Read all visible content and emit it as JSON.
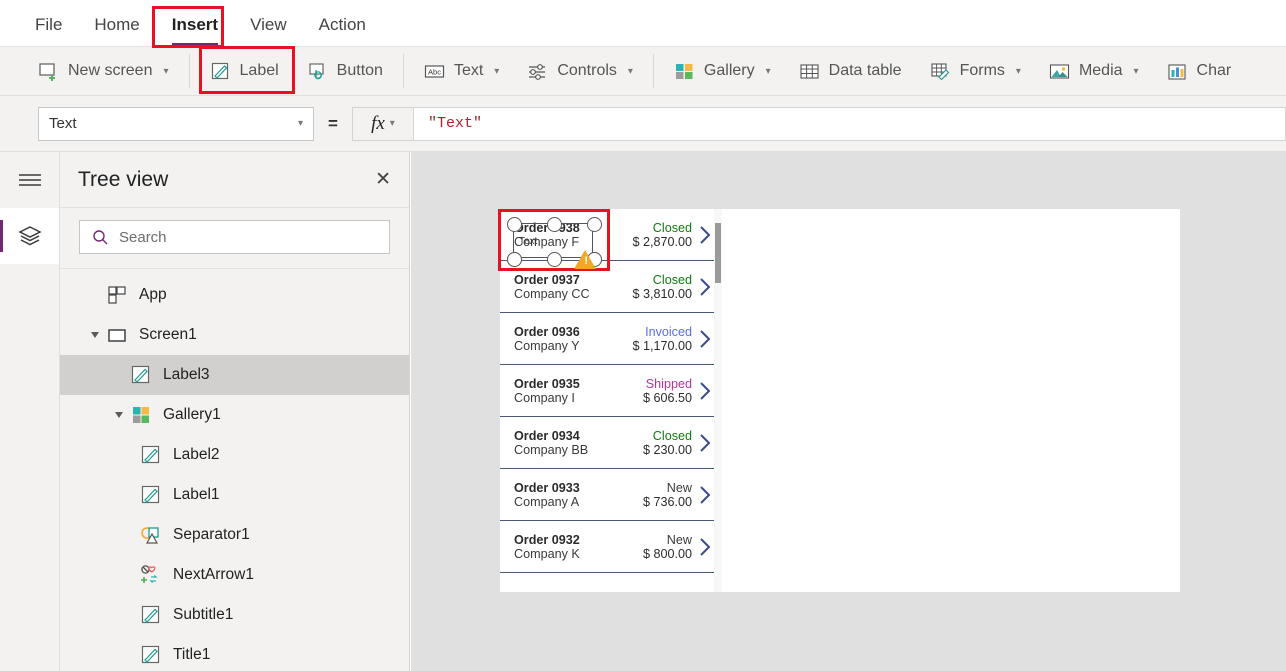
{
  "menu": {
    "tabs": [
      {
        "label": "File",
        "active": false
      },
      {
        "label": "Home",
        "active": false
      },
      {
        "label": "Insert",
        "active": true
      },
      {
        "label": "View",
        "active": false
      },
      {
        "label": "Action",
        "active": false
      }
    ]
  },
  "ribbon": {
    "items": [
      {
        "label": "New screen",
        "icon": "new-screen-icon",
        "caret": true
      },
      {
        "label": "Label",
        "icon": "label-icon",
        "caret": false
      },
      {
        "label": "Button",
        "icon": "button-icon",
        "caret": false
      },
      {
        "label": "Text",
        "icon": "text-abc-icon",
        "caret": true
      },
      {
        "label": "Controls",
        "icon": "controls-sliders-icon",
        "caret": true
      },
      {
        "label": "Gallery",
        "icon": "gallery-icon",
        "caret": true
      },
      {
        "label": "Data table",
        "icon": "data-table-icon",
        "caret": false
      },
      {
        "label": "Forms",
        "icon": "forms-icon",
        "caret": true
      },
      {
        "label": "Media",
        "icon": "media-image-icon",
        "caret": true
      },
      {
        "label": "Char",
        "icon": "chart-bars-icon",
        "caret": false
      }
    ]
  },
  "formula_bar": {
    "property": "Text",
    "equals": "=",
    "fx_label": "fx",
    "value": "\"Text\""
  },
  "tree_view": {
    "title": "Tree view",
    "close_icon": "✕",
    "search": {
      "placeholder": "Search",
      "value": ""
    },
    "items": [
      {
        "label": "App",
        "icon": "app-icon",
        "indent": 0,
        "twisty": false,
        "selected": false
      },
      {
        "label": "Screen1",
        "icon": "screen-icon",
        "indent": 0,
        "twisty": true,
        "selected": false
      },
      {
        "label": "Label3",
        "icon": "label-icon",
        "indent": 1,
        "twisty": false,
        "selected": true
      },
      {
        "label": "Gallery1",
        "icon": "gallery-icon",
        "indent": 1,
        "twisty": true,
        "selected": false
      },
      {
        "label": "Label2",
        "icon": "label-icon",
        "indent": 2,
        "twisty": false,
        "selected": false
      },
      {
        "label": "Label1",
        "icon": "label-icon",
        "indent": 2,
        "twisty": false,
        "selected": false
      },
      {
        "label": "Separator1",
        "icon": "shapes-icon",
        "indent": 2,
        "twisty": false,
        "selected": false
      },
      {
        "label": "NextArrow1",
        "icon": "icons-icon",
        "indent": 2,
        "twisty": false,
        "selected": false
      },
      {
        "label": "Subtitle1",
        "icon": "label-icon",
        "indent": 2,
        "twisty": false,
        "selected": false
      },
      {
        "label": "Title1",
        "icon": "label-icon",
        "indent": 2,
        "twisty": false,
        "selected": false
      }
    ]
  },
  "canvas": {
    "selection": {
      "placeholder_text": "Text",
      "warning_icon": "warning-triangle-icon"
    },
    "gallery": {
      "rows": [
        {
          "order": "Order 0938",
          "company": "Company F",
          "status": "Closed",
          "status_color": "#107c10",
          "amount": "$ 2,870.00"
        },
        {
          "order": "Order 0937",
          "company": "Company CC",
          "status": "Closed",
          "status_color": "#107c10",
          "amount": "$ 3,810.00"
        },
        {
          "order": "Order 0936",
          "company": "Company Y",
          "status": "Invoiced",
          "status_color": "#5b6ee1",
          "amount": "$ 1,170.00"
        },
        {
          "order": "Order 0935",
          "company": "Company I",
          "status": "Shipped",
          "status_color": "#b4359e",
          "amount": "$ 606.50"
        },
        {
          "order": "Order 0934",
          "company": "Company BB",
          "status": "Closed",
          "status_color": "#107c10",
          "amount": "$ 230.00"
        },
        {
          "order": "Order 0933",
          "company": "Company A",
          "status": "New",
          "status_color": "#3a3a3a",
          "amount": "$ 736.00"
        },
        {
          "order": "Order 0932",
          "company": "Company K",
          "status": "New",
          "status_color": "#3a3a3a",
          "amount": "$ 800.00"
        }
      ]
    }
  },
  "colors": {
    "accent_purple": "#742774",
    "annotation_red": "#e81123",
    "ribbon_bg": "#f3f2f1",
    "canvas_bg": "#e0e0e0",
    "selection_row": "#d2d0ce"
  }
}
